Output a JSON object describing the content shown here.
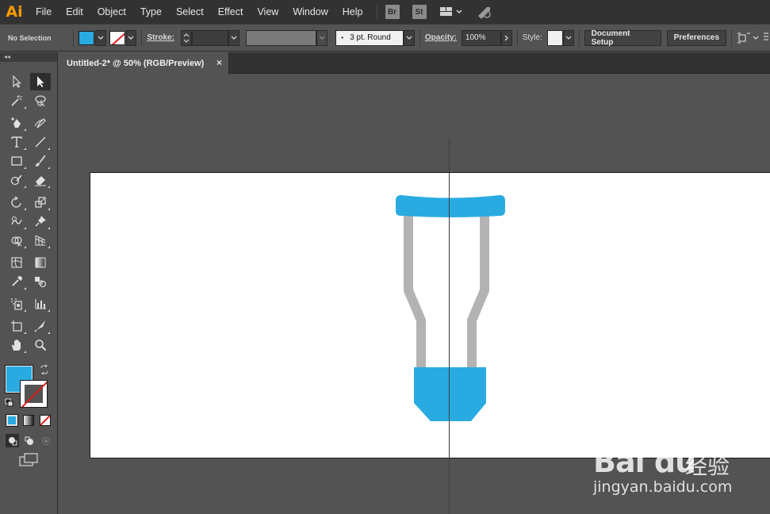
{
  "app": {
    "logo": "Ai"
  },
  "menu": [
    "File",
    "Edit",
    "Object",
    "Type",
    "Select",
    "Effect",
    "View",
    "Window",
    "Help"
  ],
  "app_badges": {
    "bridge": "Br",
    "stock": "St"
  },
  "control_bar": {
    "selection_label": "No Selection",
    "fill_color": "#29abe2",
    "stroke_label": "Stroke:",
    "brush_value": "3 pt. Round",
    "opacity_label": "Opacity:",
    "opacity_value": "100%",
    "style_label": "Style:",
    "document_setup": "Document Setup",
    "preferences": "Preferences"
  },
  "panel_toggle": "◂◂",
  "document_tab": {
    "title": "Untitled-2* @ 50% (RGB/Preview)",
    "close": "×"
  },
  "colors": {
    "fill": "#29abe2",
    "crutch_top": "#29abe2",
    "crutch_frame": "#b3b3b3",
    "crutch_base": "#29abe2"
  },
  "watermark": {
    "logo": "Bai du",
    "cn": "经验",
    "url": "jingyan.baidu.com"
  }
}
